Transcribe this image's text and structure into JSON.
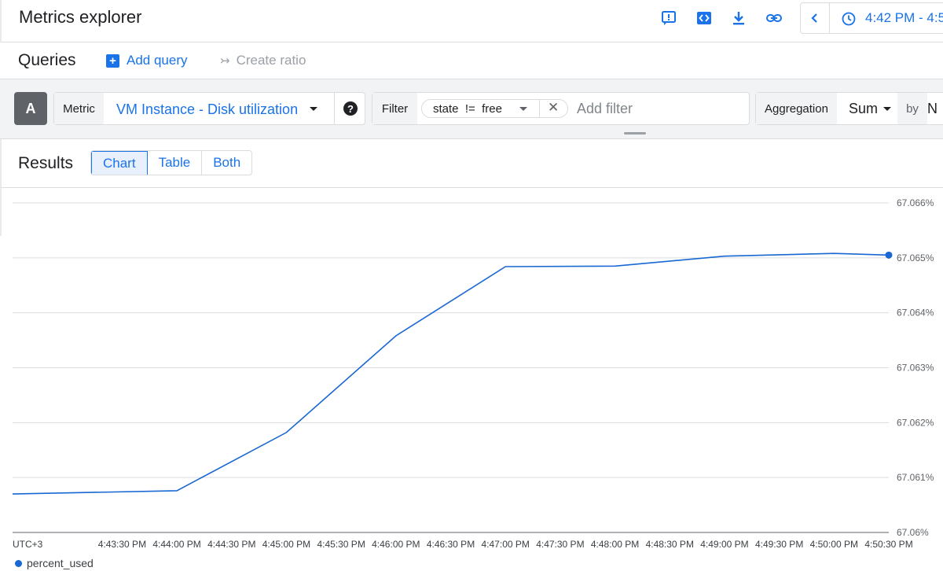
{
  "header": {
    "title": "Metrics explorer",
    "icons": [
      "feedback-icon",
      "code-icon",
      "download-icon",
      "link-icon"
    ],
    "time_range": "4:42 PM - 4:5"
  },
  "queries": {
    "title": "Queries",
    "add_query_label": "Add query",
    "create_ratio_label": "Create ratio"
  },
  "query": {
    "letter": "A",
    "metric_label": "Metric",
    "metric_value": "VM Instance - Disk utilization",
    "filter_label": "Filter",
    "filter_chip": "state  !=  free",
    "add_filter_placeholder": "Add filter",
    "aggregation_label": "Aggregation",
    "aggregation_value": "Sum",
    "by_label": "by",
    "by_value": "N"
  },
  "results": {
    "title": "Results",
    "views": [
      "Chart",
      "Table",
      "Both"
    ],
    "active_view": "Chart"
  },
  "colors": {
    "accent": "#1a73e8",
    "series": "#1967d2"
  },
  "chart_data": {
    "type": "line",
    "title": "",
    "xlabel": "",
    "ylabel": "",
    "timezone_label": "UTC+3",
    "x": [
      "4:42:30 PM",
      "4:43:30 PM",
      "4:44:00 PM",
      "4:45:00 PM",
      "4:46:00 PM",
      "4:47:00 PM",
      "4:48:00 PM",
      "4:49:00 PM",
      "4:50:00 PM",
      "4:50:30 PM"
    ],
    "x_tick_labels": [
      "4:43:30 PM",
      "4:44:00 PM",
      "4:44:30 PM",
      "4:45:00 PM",
      "4:45:30 PM",
      "4:46:00 PM",
      "4:46:30 PM",
      "4:47:00 PM",
      "4:47:30 PM",
      "4:48:00 PM",
      "4:48:30 PM",
      "4:49:00 PM",
      "4:49:30 PM",
      "4:50:00 PM",
      "4:50:30 PM"
    ],
    "y_tick_labels": [
      "67.06%",
      "67.061%",
      "67.062%",
      "67.063%",
      "67.064%",
      "67.065%",
      "67.066%"
    ],
    "ylim": [
      67.06,
      67.066
    ],
    "series": [
      {
        "name": "percent_used",
        "points": [
          {
            "x": "4:42:30 PM",
            "y": 67.0607
          },
          {
            "x": "4:44:00 PM",
            "y": 67.06076
          },
          {
            "x": "4:45:00 PM",
            "y": 67.06182
          },
          {
            "x": "4:46:00 PM",
            "y": 67.06358
          },
          {
            "x": "4:47:00 PM",
            "y": 67.06484
          },
          {
            "x": "4:48:00 PM",
            "y": 67.06485
          },
          {
            "x": "4:49:00 PM",
            "y": 67.06503
          },
          {
            "x": "4:50:00 PM",
            "y": 67.06508
          },
          {
            "x": "4:50:30 PM",
            "y": 67.06505
          }
        ]
      }
    ],
    "grid": true,
    "legend_position": "bottom-left"
  }
}
